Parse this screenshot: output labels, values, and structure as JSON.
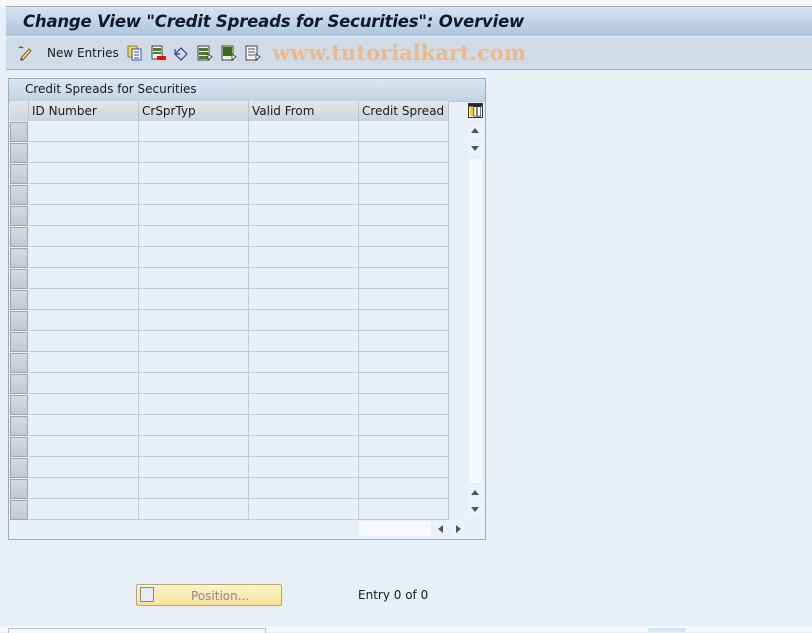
{
  "window": {
    "title": "Change View \"Credit Spreads for Securities\": Overview"
  },
  "toolbar": {
    "new_entries_label": "New Entries",
    "icons": [
      "edit-pencil-icon",
      "copy-icon",
      "delete-icon",
      "undo-icon",
      "select-all-icon",
      "select-block-icon",
      "deselect-all-icon"
    ],
    "watermark": "www.tutorialkart.com"
  },
  "table": {
    "title": "Credit Spreads for Securities",
    "columns": [
      "ID Number",
      "CrSprTyp",
      "Valid From",
      "Credit Spread"
    ],
    "row_count": 19,
    "rows": []
  },
  "footer": {
    "position_button_label": "Position...",
    "entry_status": "Entry 0 of 0"
  },
  "colors": {
    "title_bar": "#adc5dd",
    "toolbar": "#cfdce7",
    "background": "#e8eff7",
    "position_button": "#f7e39b",
    "watermark": "#f0b47c"
  }
}
